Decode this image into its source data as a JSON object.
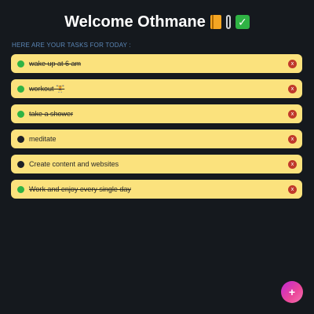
{
  "header": {
    "title": "Welcome Othmane",
    "icons": [
      "notebook-icon",
      "paperclip-icon",
      "check-mark-icon"
    ]
  },
  "subtitle": "HERE ARE YOUR TASKS FOR TODAY :",
  "tasks": [
    {
      "label": "wake up at 6 am",
      "done": true
    },
    {
      "label": "workout 🏋",
      "done": true
    },
    {
      "label": "take a shower",
      "done": true
    },
    {
      "label": "meditate",
      "done": false
    },
    {
      "label": "Create content and websites",
      "done": false
    },
    {
      "label": "Work and enjoy every single day",
      "done": true
    }
  ],
  "delete_label": "x",
  "fab_label": "+",
  "colors": {
    "background": "#15191e",
    "task_bg": "#fbe27d",
    "done_dot": "#2fb344",
    "pending_dot": "#1d2026",
    "delete": "#c0392b",
    "subtitle": "#5b86b6"
  }
}
